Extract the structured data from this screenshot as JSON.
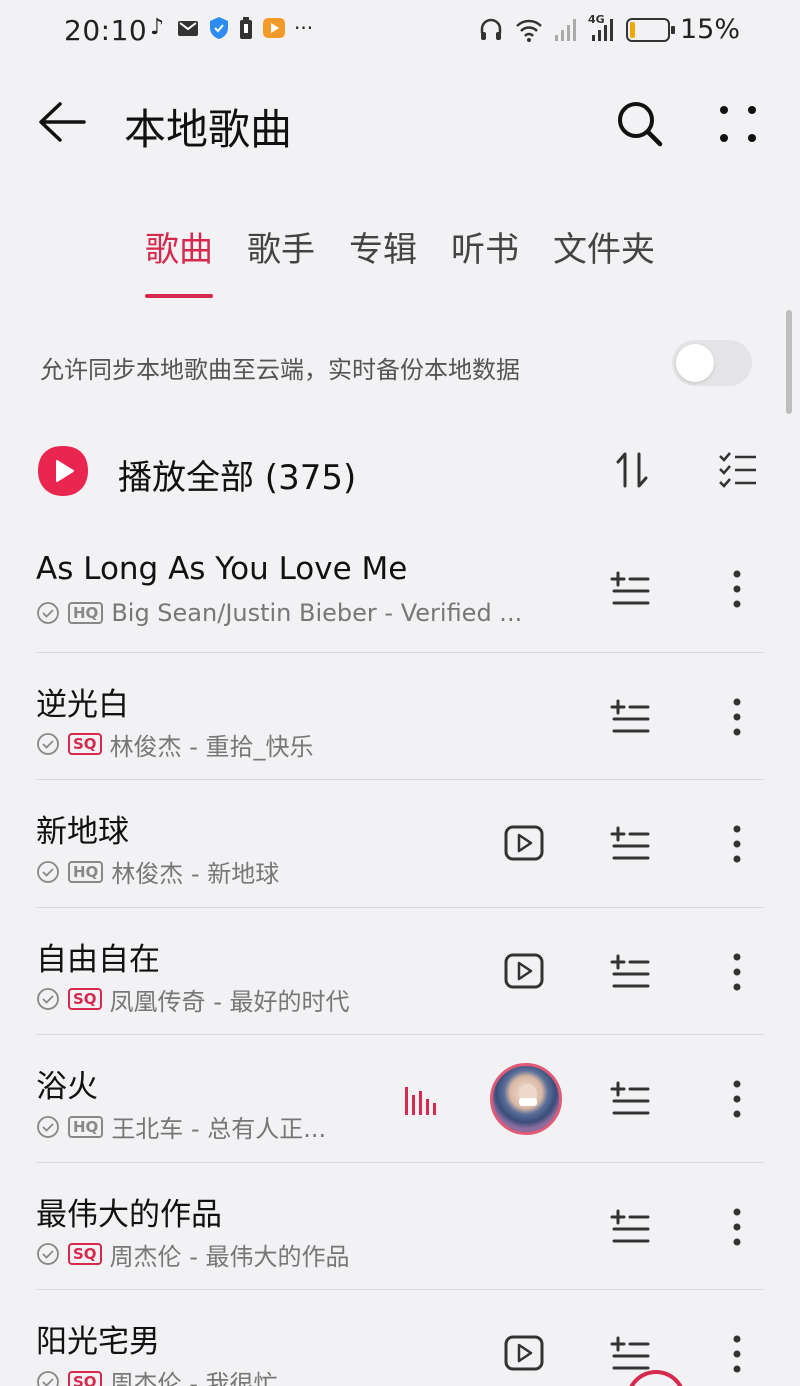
{
  "status_bar": {
    "time": "20:10",
    "battery_percent": "15%",
    "battery_level": 0.15,
    "left_icons": [
      "music-note-icon",
      "mail-icon",
      "shield-icon",
      "battery-saver-icon",
      "video-app-icon",
      "more-dots-icon"
    ],
    "right_icons": [
      "headphones-icon",
      "wifi-icon",
      "signal-icon",
      "signal-4g-icon",
      "battery-icon"
    ],
    "more_label": "···",
    "signal_4g_label": "4G"
  },
  "header": {
    "title": "本地歌曲"
  },
  "tabs": [
    {
      "label": "歌曲",
      "active": true
    },
    {
      "label": "歌手",
      "active": false
    },
    {
      "label": "专辑",
      "active": false
    },
    {
      "label": "听书",
      "active": false
    },
    {
      "label": "文件夹",
      "active": false
    }
  ],
  "sync": {
    "text": "允许同步本地歌曲至云端，实时备份本地数据",
    "enabled": false
  },
  "play_all": {
    "label": "播放全部 (375)"
  },
  "songs": [
    {
      "title": "As Long As You Love Me",
      "quality": "HQ",
      "meta": "Big Sean/Justin Bieber - Verified ...",
      "has_mv": false,
      "playing": false
    },
    {
      "title": "逆光白",
      "quality": "SQ",
      "meta": "林俊杰 - 重拾_快乐",
      "has_mv": false,
      "playing": false
    },
    {
      "title": "新地球",
      "quality": "HQ",
      "meta": "林俊杰 - 新地球",
      "has_mv": true,
      "playing": false
    },
    {
      "title": "自由自在",
      "quality": "SQ",
      "meta": "凤凰传奇 - 最好的时代",
      "has_mv": true,
      "playing": false
    },
    {
      "title": "浴火",
      "quality": "HQ",
      "meta": "王北车 - 总有人正...",
      "has_mv": false,
      "playing": true
    },
    {
      "title": "最伟大的作品",
      "quality": "SQ",
      "meta": "周杰伦 - 最伟大的作品",
      "has_mv": false,
      "playing": false
    },
    {
      "title": "阳光宅男",
      "quality": "SQ",
      "meta": "周杰伦 - 我很忙",
      "has_mv": true,
      "playing": false
    }
  ],
  "colors": {
    "accent": "#d6294d",
    "background": "#f2f2f4",
    "battery_fill": "#f0a800"
  }
}
